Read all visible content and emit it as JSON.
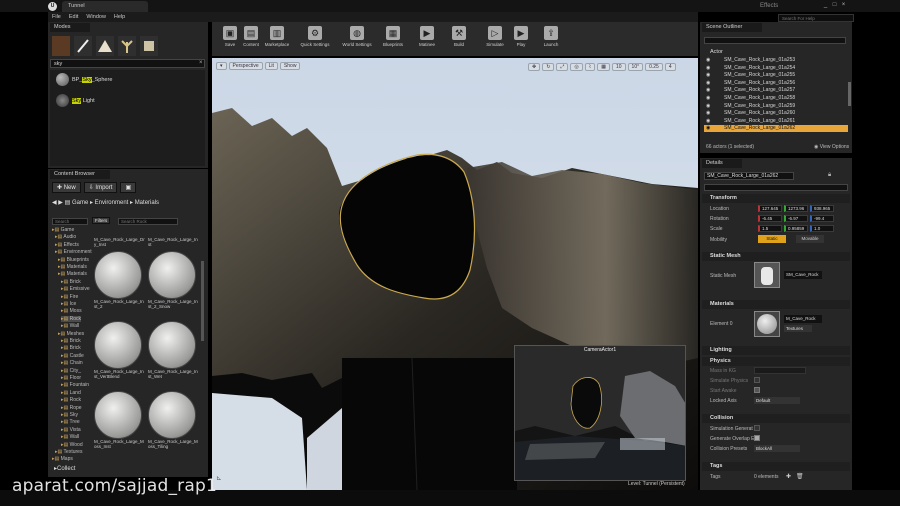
{
  "window": {
    "tab_title": "Tunnel",
    "project_label": "Effects",
    "search_help_placeholder": "Search For Help",
    "menu": [
      "File",
      "Edit",
      "Window",
      "Help"
    ]
  },
  "modes": {
    "title": "Modes",
    "search_value": "sky",
    "results": [
      {
        "prefix": "BP_",
        "match": "Sky",
        "suffix": "_Sphere"
      },
      {
        "prefix": "",
        "match": "Sky",
        "suffix": " Light"
      }
    ]
  },
  "content_browser": {
    "tab": "Content Browser",
    "new_label": "New",
    "import_label": "Import",
    "path": [
      "Game",
      "Environment",
      "Materials"
    ],
    "search_placeholder": "Search",
    "filters_label": "Filters",
    "search_assets_placeholder": "Search Rock",
    "tree": [
      "Game",
      "Audio",
      "Effects",
      "Environment",
      "Blueprints",
      "Materials",
      "Materials",
      "Brick",
      "Emissive",
      "Fire",
      "Ice",
      "Moss",
      "Rock",
      "Wall",
      "Meshes",
      "Brick",
      "Brick",
      "Castle",
      "Chain",
      "City_",
      "Floor",
      "Fountain",
      "Land",
      "Rock",
      "Rope",
      "Sky",
      "Tree",
      "Vista",
      "Wall",
      "Wood",
      "Textures",
      "Maps"
    ],
    "assets": [
      "M_Cave_Rock_Large_Dry_Inst",
      "M_Cave_Rock_Large_Inst",
      "M_Cave_Rock_Large_Inst_2",
      "M_Cave_Rock_Large_Inst_2_Snow",
      "M_Cave_Rock_Large_Inst_VertBlend",
      "M_Cave_Rock_Large_Inst_Wet",
      "M_Cave_Rock_Large_Moss_Inst",
      "M_Cave_Rock_Large_Moss_Tiling"
    ],
    "collections_label": "Collect"
  },
  "toolbar": {
    "buttons": [
      "Save",
      "Content",
      "Marketplace",
      "Quick Settings",
      "World Settings",
      "Blueprints",
      "Matinee",
      "Build",
      "Simulate",
      "Play",
      "Launch"
    ]
  },
  "viewport": {
    "perspective_label": "Perspective",
    "lit_label": "Lit",
    "show_label": "Show",
    "grid_snap": "10",
    "rot_snap": "10°",
    "scale_snap": "0.25",
    "camera_speed": "4",
    "camera_preview_title": "CameraActor1",
    "level_label": "Level: Tunnel (Persistent)"
  },
  "outliner": {
    "title": "Scene Outliner",
    "column": "Actor",
    "rows": [
      "SM_Cave_Rock_Large_01a253",
      "SM_Cave_Rock_Large_01a254",
      "SM_Cave_Rock_Large_01a255",
      "SM_Cave_Rock_Large_01a256",
      "SM_Cave_Rock_Large_01a257",
      "SM_Cave_Rock_Large_01a258",
      "SM_Cave_Rock_Large_01a259",
      "SM_Cave_Rock_Large_01a260",
      "SM_Cave_Rock_Large_01a261",
      "SM_Cave_Rock_Large_01a262"
    ],
    "selected_index": 9,
    "status": "66 actors (1 selected)",
    "view_options": "View Options"
  },
  "details": {
    "title": "Details",
    "name_value": "SM_Cave_Rock_Large_01a262",
    "transform_label": "Transform",
    "location_label": "Location",
    "location": [
      "127.645",
      "1273.96",
      "938.965"
    ],
    "rotation_label": "Rotation",
    "rotation": [
      "-6.45",
      "-6.97",
      "-99.4"
    ],
    "scale_label": "Scale",
    "scale": [
      "1.5",
      "0.95859",
      "1.0"
    ],
    "mobility_label": "Mobility",
    "mobility_static": "Static",
    "mobility_movable": "Movable",
    "static_mesh_section": "Static Mesh",
    "static_mesh_label": "Static Mesh",
    "static_mesh_value": "SM_Cave_Rock",
    "materials_section": "Materials",
    "element_label": "Element 0",
    "material_value": "M_Cave_Rock",
    "textures_label": "Textures",
    "lighting_section": "Lighting",
    "physics_section": "Physics",
    "mass_label": "Mass in KG",
    "simulate_label": "Simulate Physics",
    "start_awake_label": "Start Awake",
    "locked_axis_label": "Locked Axis",
    "locked_axis_value": "Default",
    "collision_section": "Collision",
    "sim_gen_label": "Simulation Generat",
    "overlap_label": "Generate Overlap E",
    "presets_label": "Collision Presets",
    "presets_value": "BlockAll",
    "tags_section": "Tags",
    "tags_label": "Tags",
    "tags_value": "0 elements"
  },
  "watermark": "aparat.com/sajjad_rap1"
}
